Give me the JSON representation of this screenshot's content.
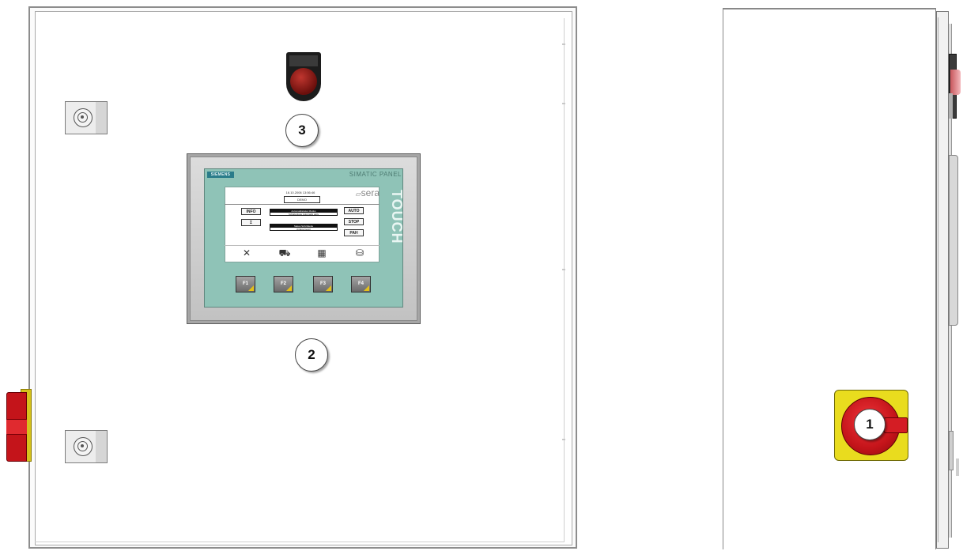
{
  "front": {
    "callouts": {
      "lamp": "3",
      "hmi": "2"
    },
    "hmi": {
      "brand": "SIEMENS",
      "panel_label": "SIMATIC PANEL",
      "touch_label": "TOUCH",
      "screen": {
        "datetime": "16.10.2006 13:56:46",
        "date_box": "DEMO",
        "logo": "sera",
        "left_buttons": [
          "INFO",
          "Σ"
        ],
        "right_buttons": [
          "AUTO",
          "STOP",
          "PAH"
        ],
        "status_1": {
          "header": "Automatikstatus Modus",
          "value": "Schaltanlage Automatik aktiv"
        },
        "status_2": {
          "header": "Status Schrittkette",
          "value": "Anlage bereit"
        },
        "bottom_icons": [
          "tools-icon",
          "pump-icon",
          "table-icon",
          "tank-icon"
        ]
      },
      "function_keys": [
        "F1",
        "F2",
        "F3",
        "F4"
      ]
    }
  },
  "side": {
    "callouts": {
      "main_switch": "1"
    }
  },
  "colors": {
    "panel_face": "#8fc3b7",
    "switch_red": "#c4141a",
    "switch_yellow": "#e9dc1e",
    "lamp_red": "#8e1b18"
  }
}
